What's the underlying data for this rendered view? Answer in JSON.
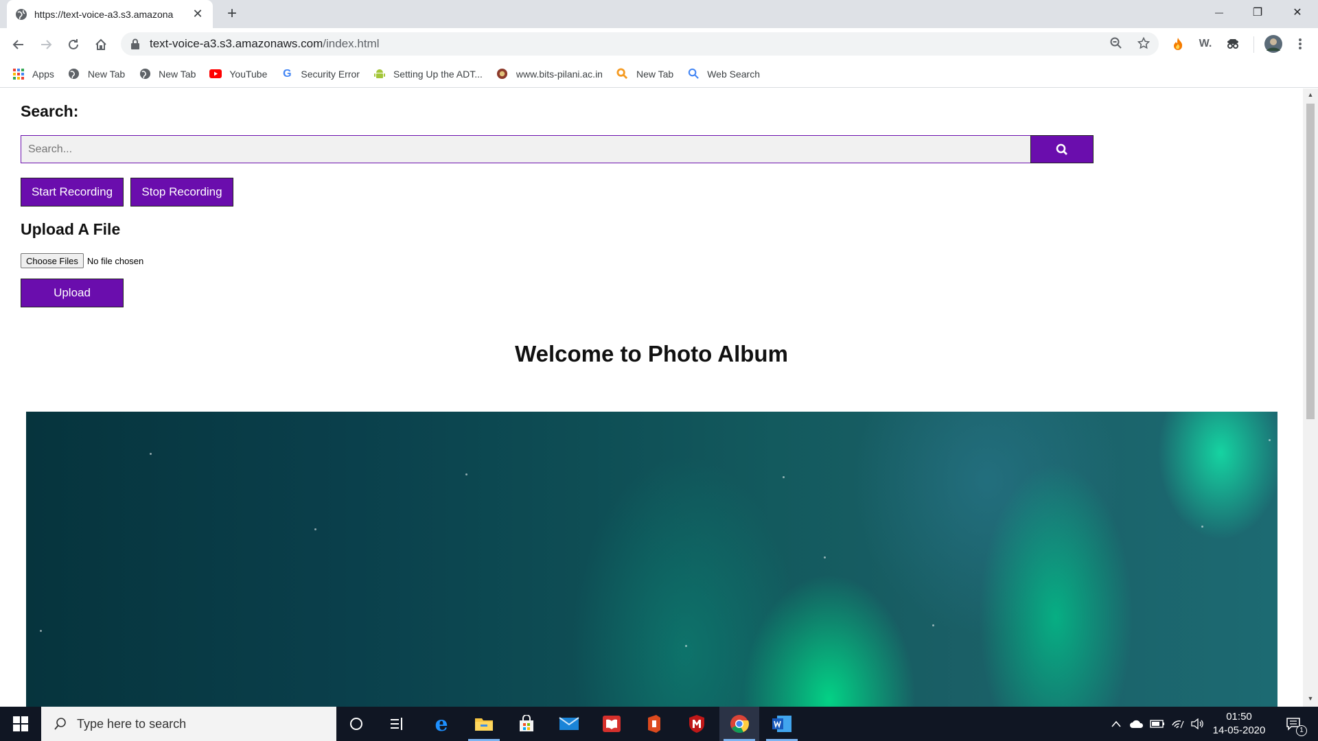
{
  "browser": {
    "tab_title": "https://text-voice-a3.s3.amazona",
    "tab_close": "✕",
    "new_tab": "+",
    "url_host": "text-voice-a3.s3.amazonaws.com",
    "url_path": "/index.html",
    "window_controls": {
      "minimize": "—",
      "restore": "❐",
      "close": "✕"
    }
  },
  "bookmarks": [
    {
      "label": "Apps",
      "icon": "apps-grid-icon"
    },
    {
      "label": "New Tab",
      "icon": "globe-icon"
    },
    {
      "label": "New Tab",
      "icon": "globe-icon"
    },
    {
      "label": "YouTube",
      "icon": "youtube-icon"
    },
    {
      "label": "Security Error",
      "icon": "google-icon"
    },
    {
      "label": "Setting Up the ADT...",
      "icon": "android-icon"
    },
    {
      "label": "www.bits-pilani.ac.in",
      "icon": "bits-icon"
    },
    {
      "label": "New Tab",
      "icon": "search-ext-icon"
    },
    {
      "label": "Web Search",
      "icon": "search-icon"
    }
  ],
  "page": {
    "search_heading": "Search:",
    "search_placeholder": "Search...",
    "start_recording": "Start Recording",
    "stop_recording": "Stop Recording",
    "upload_heading": "Upload A File",
    "choose_files": "Choose Files",
    "file_status": "No file chosen",
    "upload_button": "Upload",
    "welcome_title": "Welcome to Photo Album"
  },
  "taskbar": {
    "search_placeholder": "Type here to search",
    "time": "01:50",
    "date": "14-05-2020",
    "notification_count": "1"
  },
  "colors": {
    "accent_purple": "#6a0dad",
    "taskbar": "#101623"
  }
}
